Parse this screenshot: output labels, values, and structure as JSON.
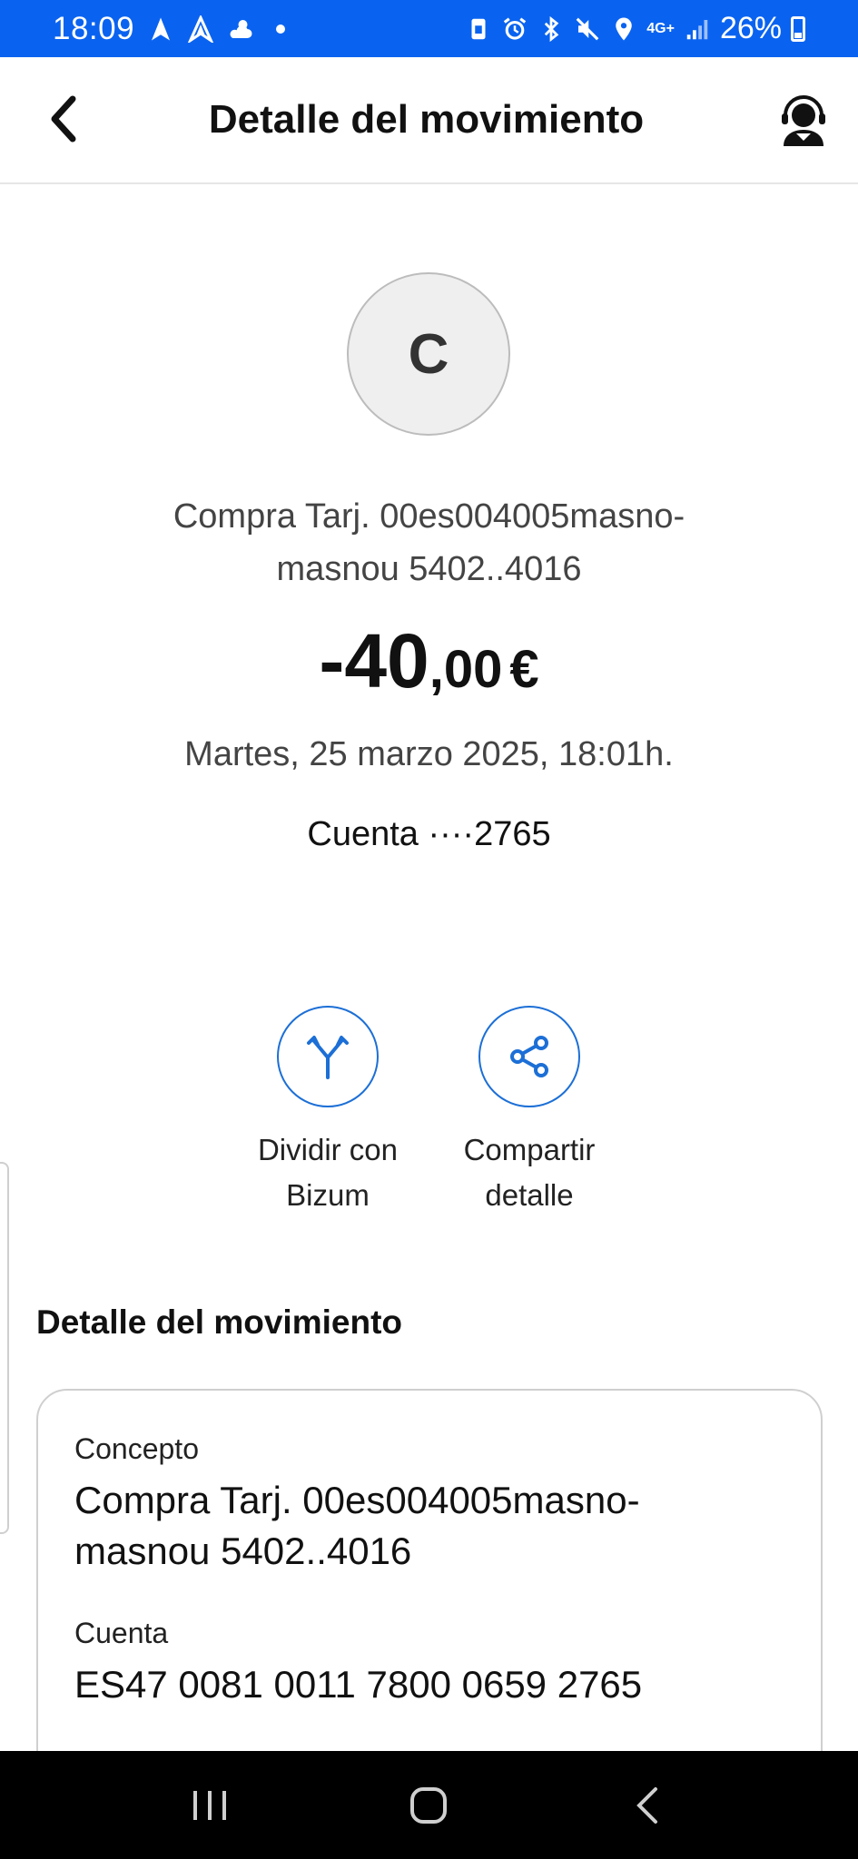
{
  "status_bar": {
    "time": "18:09",
    "battery": "26%",
    "network": "4G+",
    "bg_color": "#0a63f0",
    "left_icons": [
      "navigation-icon",
      "navigation-alt-icon",
      "weather-icon",
      "dot-icon"
    ],
    "right_icons": [
      "sim-icon",
      "alarm-icon",
      "bluetooth-icon",
      "mute-icon",
      "location-icon",
      "signal-icon",
      "battery-icon"
    ]
  },
  "header": {
    "title": "Detalle del movimiento",
    "back_icon": "chevron-left-icon",
    "support_icon": "support-agent-icon"
  },
  "transaction": {
    "avatar_letter": "C",
    "merchant_line1": "Compra Tarj. 00es004005masno-",
    "merchant_line2": "masnou 5402..4016",
    "amount_int": "-40",
    "amount_dec": ",00",
    "currency": "€",
    "date": "Martes, 25 marzo 2025, 18:01h.",
    "account_label": "Cuenta ····2765"
  },
  "actions": {
    "split": {
      "line1": "Dividir con",
      "line2": "Bizum",
      "icon": "split-icon"
    },
    "share": {
      "line1": "Compartir",
      "line2": "detalle",
      "icon": "share-icon"
    },
    "accent_color": "#1c6fd6"
  },
  "detail": {
    "section_title": "Detalle del movimiento",
    "fields": [
      {
        "label": "Concepto",
        "value_line1": "Compra Tarj. 00es004005masno-",
        "value_line2": "masnou 5402..4016"
      },
      {
        "label": "Cuenta",
        "value_line1": "ES47 0081 0011 7800 0659 2765"
      }
    ]
  },
  "nav_bar": {
    "items": [
      "recent-apps-icon",
      "home-icon",
      "back-icon"
    ]
  }
}
